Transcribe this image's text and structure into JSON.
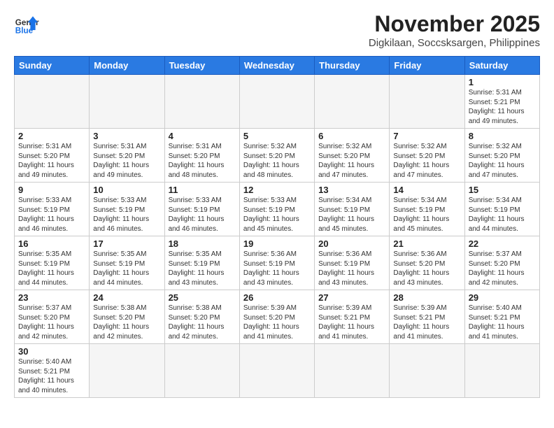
{
  "logo": {
    "line1": "General",
    "line2": "Blue"
  },
  "title": "November 2025",
  "subtitle": "Digkilaan, Soccsksargen, Philippines",
  "weekdays": [
    "Sunday",
    "Monday",
    "Tuesday",
    "Wednesday",
    "Thursday",
    "Friday",
    "Saturday"
  ],
  "weeks": [
    [
      {
        "day": "",
        "empty": true
      },
      {
        "day": "",
        "empty": true
      },
      {
        "day": "",
        "empty": true
      },
      {
        "day": "",
        "empty": true
      },
      {
        "day": "",
        "empty": true
      },
      {
        "day": "",
        "empty": true
      },
      {
        "day": "1",
        "sunrise": "5:31 AM",
        "sunset": "5:21 PM",
        "daylight": "11 hours and 49 minutes."
      }
    ],
    [
      {
        "day": "2",
        "sunrise": "5:31 AM",
        "sunset": "5:20 PM",
        "daylight": "11 hours and 49 minutes."
      },
      {
        "day": "3",
        "sunrise": "5:31 AM",
        "sunset": "5:20 PM",
        "daylight": "11 hours and 49 minutes."
      },
      {
        "day": "4",
        "sunrise": "5:31 AM",
        "sunset": "5:20 PM",
        "daylight": "11 hours and 48 minutes."
      },
      {
        "day": "5",
        "sunrise": "5:32 AM",
        "sunset": "5:20 PM",
        "daylight": "11 hours and 48 minutes."
      },
      {
        "day": "6",
        "sunrise": "5:32 AM",
        "sunset": "5:20 PM",
        "daylight": "11 hours and 47 minutes."
      },
      {
        "day": "7",
        "sunrise": "5:32 AM",
        "sunset": "5:20 PM",
        "daylight": "11 hours and 47 minutes."
      },
      {
        "day": "8",
        "sunrise": "5:32 AM",
        "sunset": "5:20 PM",
        "daylight": "11 hours and 47 minutes."
      }
    ],
    [
      {
        "day": "9",
        "sunrise": "5:33 AM",
        "sunset": "5:19 PM",
        "daylight": "11 hours and 46 minutes."
      },
      {
        "day": "10",
        "sunrise": "5:33 AM",
        "sunset": "5:19 PM",
        "daylight": "11 hours and 46 minutes."
      },
      {
        "day": "11",
        "sunrise": "5:33 AM",
        "sunset": "5:19 PM",
        "daylight": "11 hours and 46 minutes."
      },
      {
        "day": "12",
        "sunrise": "5:33 AM",
        "sunset": "5:19 PM",
        "daylight": "11 hours and 45 minutes."
      },
      {
        "day": "13",
        "sunrise": "5:34 AM",
        "sunset": "5:19 PM",
        "daylight": "11 hours and 45 minutes."
      },
      {
        "day": "14",
        "sunrise": "5:34 AM",
        "sunset": "5:19 PM",
        "daylight": "11 hours and 45 minutes."
      },
      {
        "day": "15",
        "sunrise": "5:34 AM",
        "sunset": "5:19 PM",
        "daylight": "11 hours and 44 minutes."
      }
    ],
    [
      {
        "day": "16",
        "sunrise": "5:35 AM",
        "sunset": "5:19 PM",
        "daylight": "11 hours and 44 minutes."
      },
      {
        "day": "17",
        "sunrise": "5:35 AM",
        "sunset": "5:19 PM",
        "daylight": "11 hours and 44 minutes."
      },
      {
        "day": "18",
        "sunrise": "5:35 AM",
        "sunset": "5:19 PM",
        "daylight": "11 hours and 43 minutes."
      },
      {
        "day": "19",
        "sunrise": "5:36 AM",
        "sunset": "5:19 PM",
        "daylight": "11 hours and 43 minutes."
      },
      {
        "day": "20",
        "sunrise": "5:36 AM",
        "sunset": "5:19 PM",
        "daylight": "11 hours and 43 minutes."
      },
      {
        "day": "21",
        "sunrise": "5:36 AM",
        "sunset": "5:20 PM",
        "daylight": "11 hours and 43 minutes."
      },
      {
        "day": "22",
        "sunrise": "5:37 AM",
        "sunset": "5:20 PM",
        "daylight": "11 hours and 42 minutes."
      }
    ],
    [
      {
        "day": "23",
        "sunrise": "5:37 AM",
        "sunset": "5:20 PM",
        "daylight": "11 hours and 42 minutes."
      },
      {
        "day": "24",
        "sunrise": "5:38 AM",
        "sunset": "5:20 PM",
        "daylight": "11 hours and 42 minutes."
      },
      {
        "day": "25",
        "sunrise": "5:38 AM",
        "sunset": "5:20 PM",
        "daylight": "11 hours and 42 minutes."
      },
      {
        "day": "26",
        "sunrise": "5:39 AM",
        "sunset": "5:20 PM",
        "daylight": "11 hours and 41 minutes."
      },
      {
        "day": "27",
        "sunrise": "5:39 AM",
        "sunset": "5:21 PM",
        "daylight": "11 hours and 41 minutes."
      },
      {
        "day": "28",
        "sunrise": "5:39 AM",
        "sunset": "5:21 PM",
        "daylight": "11 hours and 41 minutes."
      },
      {
        "day": "29",
        "sunrise": "5:40 AM",
        "sunset": "5:21 PM",
        "daylight": "11 hours and 41 minutes."
      }
    ],
    [
      {
        "day": "30",
        "sunrise": "5:40 AM",
        "sunset": "5:21 PM",
        "daylight": "11 hours and 40 minutes."
      },
      {
        "day": "",
        "empty": true
      },
      {
        "day": "",
        "empty": true
      },
      {
        "day": "",
        "empty": true
      },
      {
        "day": "",
        "empty": true
      },
      {
        "day": "",
        "empty": true
      },
      {
        "day": "",
        "empty": true
      }
    ]
  ]
}
